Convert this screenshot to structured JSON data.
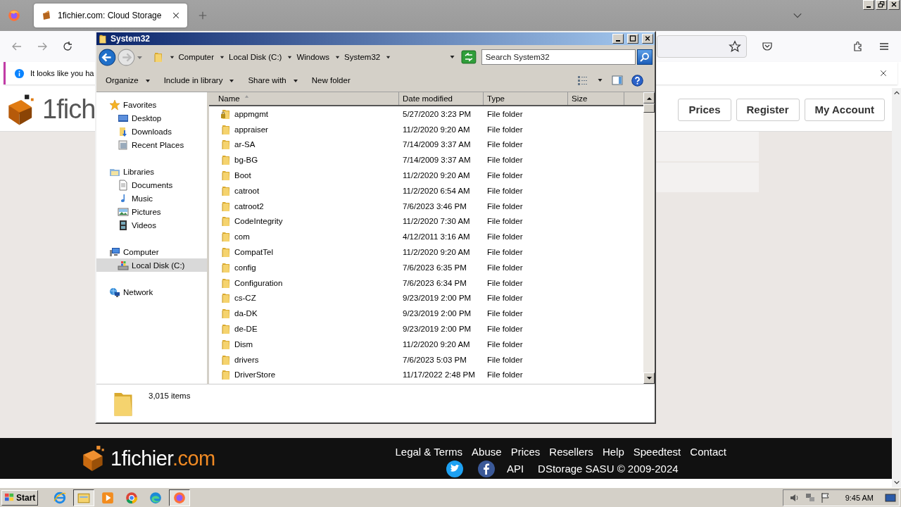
{
  "browser": {
    "tab": {
      "title": "1fichier.com: Cloud Storage",
      "selected": true
    },
    "notification": {
      "text": "It looks like you ha"
    },
    "site": {
      "logo": "1fich",
      "nav_buttons": [
        {
          "label": "Prices"
        },
        {
          "label": "Register"
        },
        {
          "label": "My Account"
        }
      ]
    },
    "footer": {
      "logo_main": "1fichier",
      "logo_suffix": ".com",
      "links": [
        "Legal & Terms",
        "Abuse",
        "Prices",
        "Resellers",
        "Help",
        "Speedtest",
        "Contact"
      ],
      "api_link": "API",
      "copyright": "DStorage SASU © 2009-2024"
    }
  },
  "explorer": {
    "title": "System32",
    "breadcrumb": [
      "Computer",
      "Local Disk (C:)",
      "Windows",
      "System32"
    ],
    "search": {
      "placeholder": "Search System32"
    },
    "toolbar": [
      {
        "label": "Organize",
        "dropdown": true
      },
      {
        "label": "Include in library",
        "dropdown": true
      },
      {
        "label": "Share with",
        "dropdown": true
      },
      {
        "label": "New folder",
        "dropdown": false
      }
    ],
    "nav": [
      {
        "label": "Favorites",
        "kind": "favorites",
        "selected": false,
        "children": [
          {
            "label": "Desktop",
            "kind": "desktop",
            "selected": false
          },
          {
            "label": "Downloads",
            "kind": "downloads",
            "selected": false
          },
          {
            "label": "Recent Places",
            "kind": "recent",
            "selected": false
          }
        ]
      },
      {
        "label": "Libraries",
        "kind": "libraries",
        "selected": false,
        "children": [
          {
            "label": "Documents",
            "kind": "documents",
            "selected": false
          },
          {
            "label": "Music",
            "kind": "music",
            "selected": false
          },
          {
            "label": "Pictures",
            "kind": "pictures",
            "selected": false
          },
          {
            "label": "Videos",
            "kind": "videos",
            "selected": false
          }
        ]
      },
      {
        "label": "Computer",
        "kind": "computer",
        "selected": false,
        "children": [
          {
            "label": "Local Disk (C:)",
            "kind": "disk",
            "selected": true
          }
        ]
      },
      {
        "label": "Network",
        "kind": "network",
        "selected": false
      }
    ],
    "columns": [
      {
        "label": "Name",
        "sorted": true
      },
      {
        "label": "Date modified",
        "sorted": false
      },
      {
        "label": "Type",
        "sorted": false
      },
      {
        "label": "Size",
        "sorted": false
      }
    ],
    "rows": [
      {
        "name": "appmgmt",
        "date": "5/27/2020 3:23 PM",
        "type": "File folder",
        "locked": true
      },
      {
        "name": "appraiser",
        "date": "11/2/2020 9:20 AM",
        "type": "File folder",
        "locked": false
      },
      {
        "name": "ar-SA",
        "date": "7/14/2009 3:37 AM",
        "type": "File folder",
        "locked": false
      },
      {
        "name": "bg-BG",
        "date": "7/14/2009 3:37 AM",
        "type": "File folder",
        "locked": false
      },
      {
        "name": "Boot",
        "date": "11/2/2020 9:20 AM",
        "type": "File folder",
        "locked": false
      },
      {
        "name": "catroot",
        "date": "11/2/2020 6:54 AM",
        "type": "File folder",
        "locked": false
      },
      {
        "name": "catroot2",
        "date": "7/6/2023 3:46 PM",
        "type": "File folder",
        "locked": false
      },
      {
        "name": "CodeIntegrity",
        "date": "11/2/2020 7:30 AM",
        "type": "File folder",
        "locked": false
      },
      {
        "name": "com",
        "date": "4/12/2011 3:16 AM",
        "type": "File folder",
        "locked": false
      },
      {
        "name": "CompatTel",
        "date": "11/2/2020 9:20 AM",
        "type": "File folder",
        "locked": false
      },
      {
        "name": "config",
        "date": "7/6/2023 6:35 PM",
        "type": "File folder",
        "locked": false
      },
      {
        "name": "Configuration",
        "date": "7/6/2023 6:34 PM",
        "type": "File folder",
        "locked": false
      },
      {
        "name": "cs-CZ",
        "date": "9/23/2019 2:00 PM",
        "type": "File folder",
        "locked": false
      },
      {
        "name": "da-DK",
        "date": "9/23/2019 2:00 PM",
        "type": "File folder",
        "locked": false
      },
      {
        "name": "de-DE",
        "date": "9/23/2019 2:00 PM",
        "type": "File folder",
        "locked": false
      },
      {
        "name": "Dism",
        "date": "11/2/2020 9:20 AM",
        "type": "File folder",
        "locked": false
      },
      {
        "name": "drivers",
        "date": "7/6/2023 5:03 PM",
        "type": "File folder",
        "locked": false
      },
      {
        "name": "DriverStore",
        "date": "11/17/2022 2:48 PM",
        "type": "File folder",
        "locked": false
      }
    ],
    "status": "3,015 items"
  },
  "taskbar": {
    "start": "Start",
    "apps": [
      {
        "kind": "ie",
        "pressed": false
      },
      {
        "kind": "explorer",
        "pressed": true
      },
      {
        "kind": "media",
        "pressed": false
      },
      {
        "kind": "chrome",
        "pressed": false
      },
      {
        "kind": "edge",
        "pressed": false
      },
      {
        "kind": "firefox",
        "pressed": true
      }
    ],
    "clock": "9:45 AM"
  }
}
